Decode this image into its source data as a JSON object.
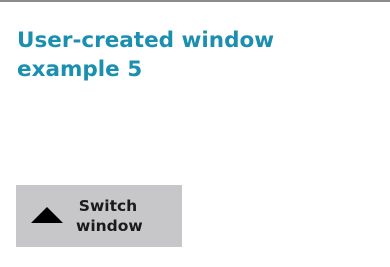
{
  "window": {
    "title": "User-created window example 5",
    "accent_color": "#1b8fb0"
  },
  "switch_button": {
    "icon": "triangle-up-icon",
    "label": "Switch window",
    "background": "#c7c7c9"
  }
}
